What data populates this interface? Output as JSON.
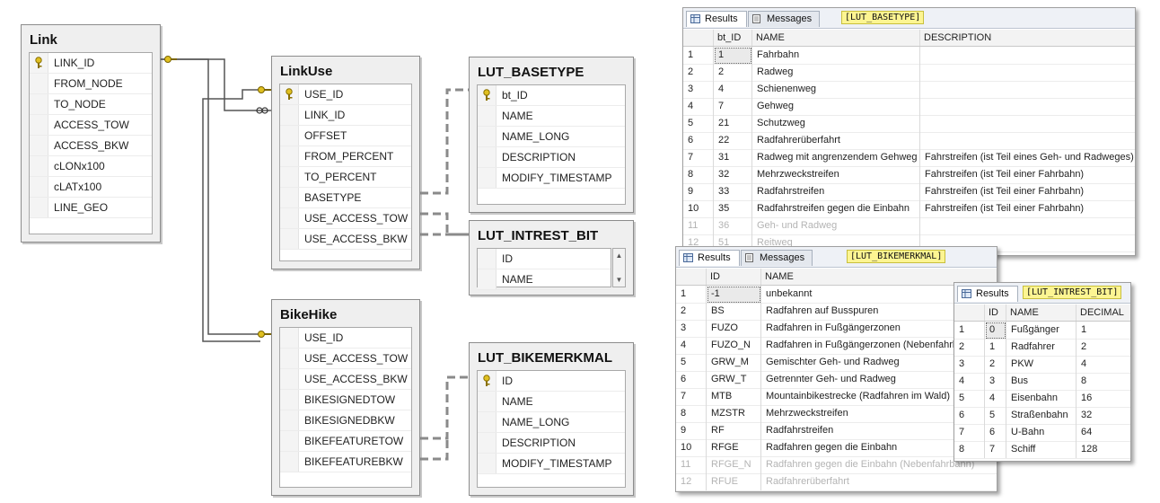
{
  "diagram": {
    "link": {
      "title": "Link",
      "columns": [
        "LINK_ID",
        "FROM_NODE",
        "TO_NODE",
        "ACCESS_TOW",
        "ACCESS_BKW",
        "cLONx100",
        "cLATx100",
        "LINE_GEO"
      ]
    },
    "linkuse": {
      "title": "LinkUse",
      "columns": [
        "USE_ID",
        "LINK_ID",
        "OFFSET",
        "FROM_PERCENT",
        "TO_PERCENT",
        "BASETYPE",
        "USE_ACCESS_TOW",
        "USE_ACCESS_BKW"
      ]
    },
    "lut_basetype": {
      "title": "LUT_BASETYPE",
      "columns": [
        "bt_ID",
        "NAME",
        "NAME_LONG",
        "DESCRIPTION",
        "MODIFY_TIMESTAMP"
      ]
    },
    "lut_intrest_bit": {
      "title": "LUT_INTREST_BIT",
      "columns": [
        "ID",
        "NAME"
      ]
    },
    "bikehike": {
      "title": "BikeHike",
      "columns": [
        "USE_ID",
        "USE_ACCESS_TOW",
        "USE_ACCESS_BKW",
        "BIKESIGNEDTOW",
        "BIKESIGNEDBKW",
        "BIKEFEATURETOW",
        "BIKEFEATUREBKW"
      ]
    },
    "lut_bikemerkmal": {
      "title": "LUT_BIKEMERKMAL",
      "columns": [
        "ID",
        "NAME",
        "NAME_LONG",
        "DESCRIPTION",
        "MODIFY_TIMESTAMP"
      ]
    }
  },
  "grids": {
    "tab_results": "Results",
    "tab_messages": "Messages",
    "basetype": {
      "label": "[LUT_BASETYPE]",
      "headers": [
        "bt_ID",
        "NAME",
        "DESCRIPTION"
      ],
      "rows": [
        [
          "1",
          "1",
          "Fahrbahn",
          ""
        ],
        [
          "2",
          "2",
          "Radweg",
          ""
        ],
        [
          "3",
          "4",
          "Schienenweg",
          ""
        ],
        [
          "4",
          "7",
          "Gehweg",
          ""
        ],
        [
          "5",
          "21",
          "Schutzweg",
          ""
        ],
        [
          "6",
          "22",
          "Radfahrerüberfahrt",
          ""
        ],
        [
          "7",
          "31",
          "Radweg mit angrenzendem Gehweg",
          "Fahrstreifen (ist Teil eines Geh- und Radweges)"
        ],
        [
          "8",
          "32",
          "Mehrzweckstreifen",
          "Fahrstreifen (ist Teil einer Fahrbahn)"
        ],
        [
          "9",
          "33",
          "Radfahrstreifen",
          "Fahrstreifen (ist Teil einer Fahrbahn)"
        ],
        [
          "10",
          "35",
          "Radfahrstreifen gegen die Einbahn",
          "Fahrstreifen (ist Teil einer Fahrbahn)"
        ],
        [
          "11",
          "36",
          "Geh- und Radweg",
          ""
        ],
        [
          "12",
          "51",
          "Reitweg",
          ""
        ]
      ]
    },
    "bikemerkmal": {
      "label": "[LUT_BIKEMERKMAL]",
      "headers": [
        "ID",
        "NAME"
      ],
      "rows": [
        [
          "1",
          "-1",
          "unbekannt"
        ],
        [
          "2",
          "BS",
          "Radfahren auf Busspuren"
        ],
        [
          "3",
          "FUZO",
          "Radfahren in Fußgängerzonen"
        ],
        [
          "4",
          "FUZO_N",
          "Radfahren in Fußgängerzonen (Nebenfahrb"
        ],
        [
          "5",
          "GRW_M",
          "Gemischter Geh- und Radweg"
        ],
        [
          "6",
          "GRW_T",
          "Getrennter Geh- und Radweg"
        ],
        [
          "7",
          "MTB",
          "Mountainbikestrecke (Radfahren im Wald)"
        ],
        [
          "8",
          "MZSTR",
          "Mehrzweckstreifen"
        ],
        [
          "9",
          "RF",
          "Radfahrstreifen"
        ],
        [
          "10",
          "RFGE",
          "Radfahren gegen die Einbahn"
        ],
        [
          "11",
          "RFGE_N",
          "Radfahren gegen die Einbahn (Nebenfahrbahn)"
        ],
        [
          "12",
          "RFUE",
          "Radfahrerüberfahrt"
        ]
      ]
    },
    "intrest_bit": {
      "label": "[LUT_INTREST_BIT]",
      "headers": [
        "ID",
        "NAME",
        "DECIMAL"
      ],
      "rows": [
        [
          "1",
          "0",
          "Fußgänger",
          "1"
        ],
        [
          "2",
          "1",
          "Radfahrer",
          "2"
        ],
        [
          "3",
          "2",
          "PKW",
          "4"
        ],
        [
          "4",
          "3",
          "Bus",
          "8"
        ],
        [
          "5",
          "4",
          "Eisenbahn",
          "16"
        ],
        [
          "6",
          "5",
          "Straßenbahn",
          "32"
        ],
        [
          "7",
          "6",
          "U-Bahn",
          "64"
        ],
        [
          "8",
          "7",
          "Schiff",
          "128"
        ]
      ]
    }
  },
  "colors": {
    "key_gold": "#e0c020",
    "connector": "#555555",
    "highlight": "#fdf592"
  }
}
